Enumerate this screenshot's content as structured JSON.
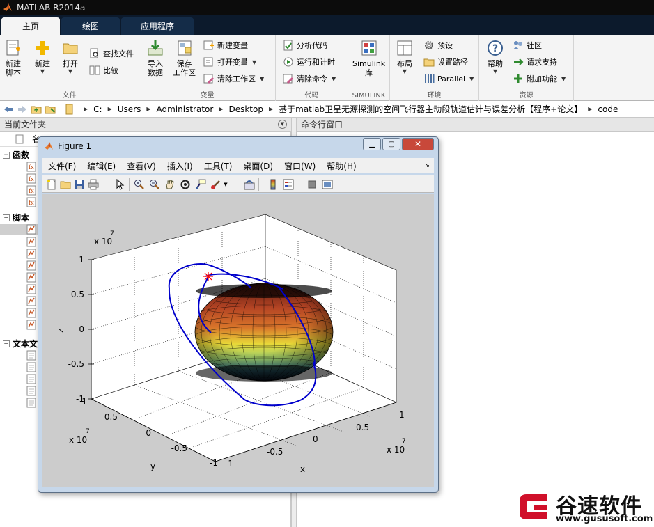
{
  "app": {
    "title": "MATLAB R2014a"
  },
  "ribbon_tabs": [
    "主页",
    "绘图",
    "应用程序"
  ],
  "groups": {
    "file": {
      "title": "文件",
      "new_script": [
        "新建",
        "脚本"
      ],
      "new": "新建",
      "open": "打开",
      "find_files": "查找文件",
      "compare": "比较"
    },
    "variable": {
      "title": "变量",
      "import": [
        "导入",
        "数据"
      ],
      "save": [
        "保存",
        "工作区"
      ],
      "new_var": "新建变量",
      "open_var": "打开变量",
      "clear_ws": "清除工作区"
    },
    "code": {
      "title": "代码",
      "analyze": "分析代码",
      "run_time": "运行和计时",
      "clear_cmd": "清除命令"
    },
    "simulink": {
      "title": "SIMULINK",
      "lib": [
        "Simulink",
        "库"
      ]
    },
    "env": {
      "title": "环境",
      "layout": "布局",
      "prefs": "预设",
      "set_path": "设置路径",
      "parallel": "Parallel"
    },
    "resources": {
      "title": "资源",
      "help": "帮助",
      "community": "社区",
      "support": "请求支持",
      "addons": "附加功能"
    }
  },
  "address": {
    "crumbs": [
      "C:",
      "Users",
      "Administrator",
      "Desktop",
      "基于matlab卫星无源探测的空间飞行器主动段轨道估计与误差分析【程序+论文】",
      "code"
    ]
  },
  "panels": {
    "current_folder": "当前文件夹",
    "command_window": "命令行窗口",
    "name_col": "名"
  },
  "tree": {
    "functions": "函数",
    "scripts": "脚本",
    "text_files": "文本文"
  },
  "figure": {
    "title": "Figure 1",
    "menus": [
      "文件(F)",
      "编辑(E)",
      "查看(V)",
      "插入(I)",
      "工具(T)",
      "桌面(D)",
      "窗口(W)",
      "帮助(H)"
    ],
    "plot": {
      "exponent_base": "x 10",
      "exponent_power": "7",
      "z_label": "z",
      "y_label": "y",
      "x_label": "x",
      "z_ticks": [
        "1",
        "0.5",
        "0",
        "-0.5",
        "-1"
      ],
      "y_ticks": [
        "1",
        "0.5",
        "0",
        "-0.5",
        "-1"
      ],
      "x_ticks": [
        "-1",
        "-0.5",
        "0",
        "0.5",
        "1"
      ]
    }
  },
  "watermark": {
    "brand": "谷速软件",
    "url": "www.gususoft.com"
  },
  "colors": {
    "accent": "#0c1a2c",
    "orbit": "#0000cc",
    "marker": "#ff0000"
  }
}
